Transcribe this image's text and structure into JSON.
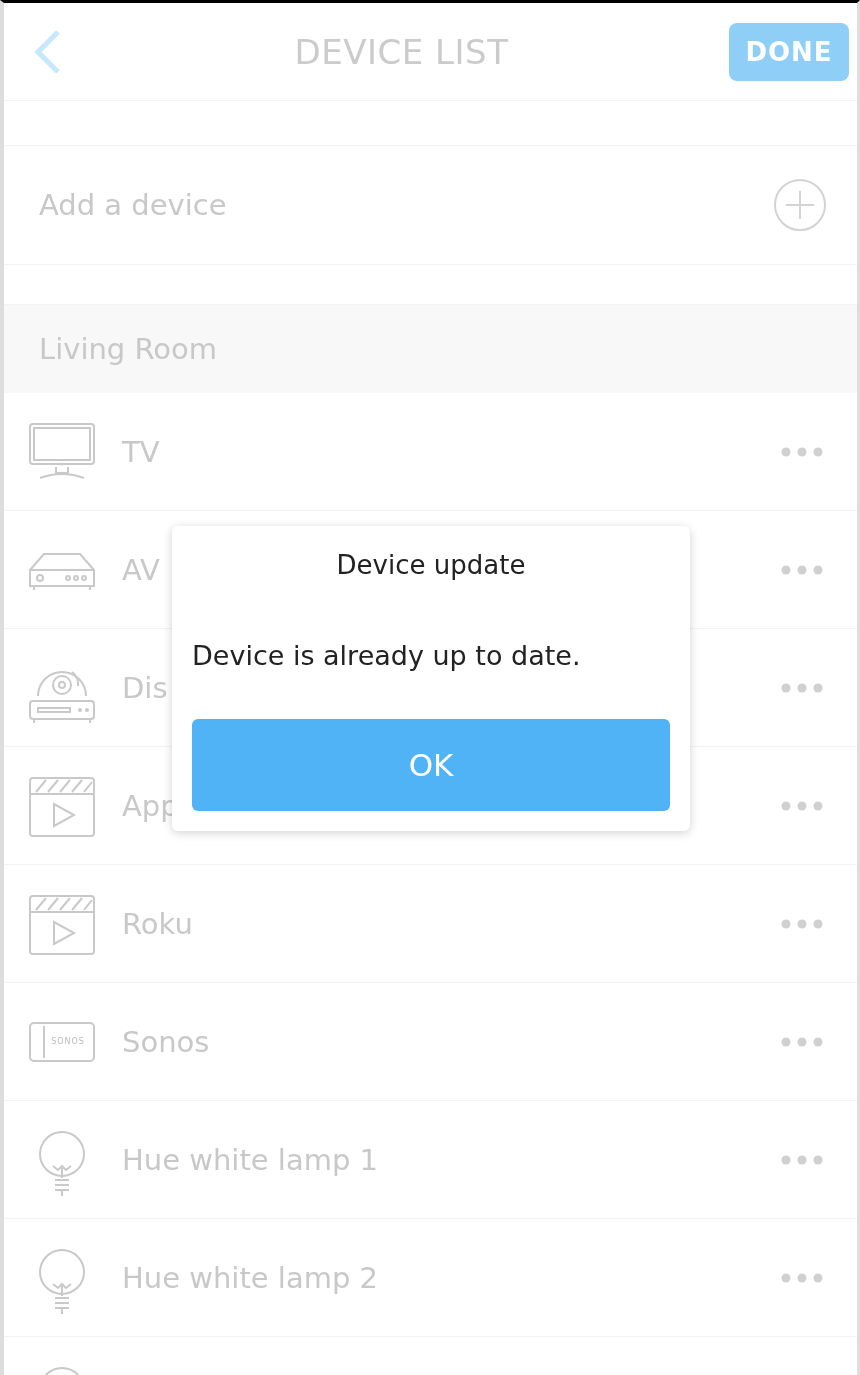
{
  "header": {
    "title": "DEVICE LIST",
    "done_button": "DONE"
  },
  "add_device": {
    "label": "Add a device"
  },
  "section": {
    "title": "Living Room"
  },
  "devices": [
    {
      "kind": "tv",
      "name": "TV"
    },
    {
      "kind": "av",
      "name": "AV"
    },
    {
      "kind": "disc",
      "name": "Dis"
    },
    {
      "kind": "app",
      "name": "App"
    },
    {
      "kind": "app",
      "name": "Roku"
    },
    {
      "kind": "sonos",
      "name": "Sonos",
      "icon_label": "SONOS"
    },
    {
      "kind": "bulb",
      "name": "Hue white lamp 1"
    },
    {
      "kind": "bulb",
      "name": "Hue white lamp 2"
    },
    {
      "kind": "bulb"
    }
  ],
  "dialog": {
    "title": "Device update",
    "message": "Device is already up to date.",
    "button": "OK"
  }
}
